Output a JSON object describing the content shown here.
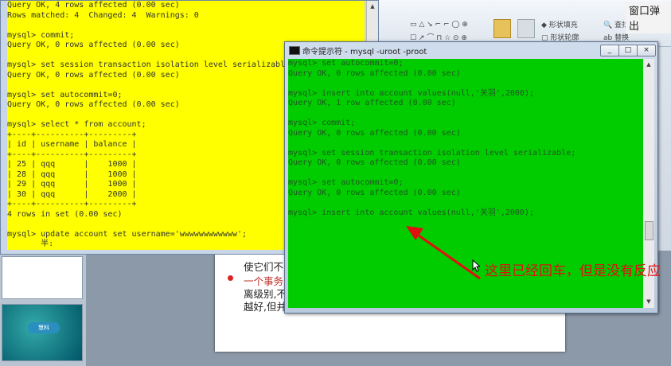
{
  "corner_title": "窗口弹出",
  "ribbon": {
    "shape_fill": "形状填充",
    "shape_outline": "形状轮廓",
    "find": "查找",
    "replace": "替换"
  },
  "yellow_console": {
    "lines": [
      "Query OK, 4 rows affected (0.00 sec)",
      "Rows matched: 4  Changed: 4  Warnings: 0",
      "",
      "mysql> commit;",
      "Query OK, 0 rows affected (0.00 sec)",
      "",
      "mysql> set session transaction isolation level serializable;",
      "Query OK, 0 rows affected (0.00 sec)",
      "",
      "mysql> set autocommit=0;",
      "Query OK, 0 rows affected (0.00 sec)",
      "",
      "mysql> select * from account;",
      "+----+----------+---------+",
      "| id | username | balance |",
      "+----+----------+---------+",
      "| 25 | qqq      |    1000 |",
      "| 28 | qqq      |    1000 |",
      "| 29 | qqq      |    1000 |",
      "| 30 | qqq      |    2000 |",
      "+----+----------+---------+",
      "4 rows in set (0.00 sec)",
      "",
      "mysql> update account set username='wwwwwwwwwwww';",
      "       半:"
    ]
  },
  "green_window": {
    "title": "命令提示符 - mysql  -uroot -proot",
    "minimize": "_",
    "maximize": "□",
    "close": "×"
  },
  "green_console": {
    "lines": [
      "mysql> set autocommit=0;",
      "Query OK, 0 rows affected (0.00 sec)",
      "",
      "mysql> insert into account values(null,'关羽',2000);",
      "Query OK, 1 row affected (0.00 sec)",
      "",
      "mysql> commit;",
      "Query OK, 0 rows affected (0.00 sec)",
      "",
      "mysql> set session transaction isolation level serializable;",
      "Query OK, 0 rows affected (0.00 sec)",
      "",
      "mysql> set autocommit=0;",
      "Query OK, 0 rows affected (0.00 sec)",
      "",
      "mysql> insert into account values(null,'关羽',2000);"
    ]
  },
  "slide": {
    "line1": "使它们不",
    "line2": "一个事务",
    "line3": "离级别,不",
    "line4": "越好,但并"
  },
  "thumb_logo": "慧科",
  "annotation": "这里已经回车，但是没有反应",
  "colors": {
    "yellow_bg": "#ffff00",
    "green_bg": "#00cc00",
    "annotation_red": "#e01010"
  }
}
